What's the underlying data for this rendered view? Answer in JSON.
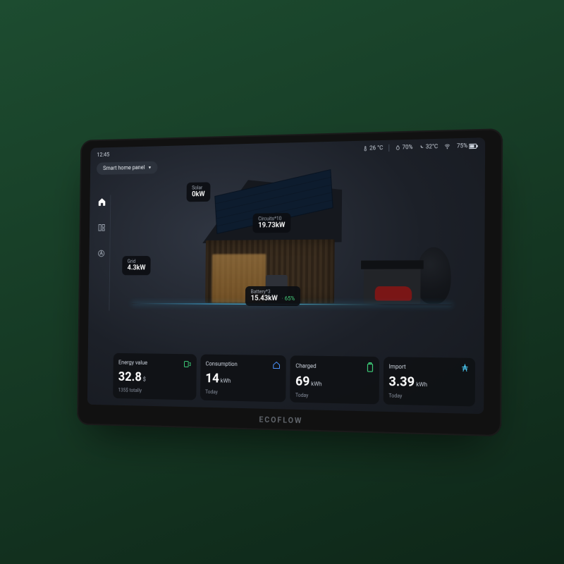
{
  "status": {
    "time": "12:45",
    "weather1_temp": "26 °C",
    "humidity": "70%",
    "weather2_temp": "32°C",
    "battery_pct": "75%"
  },
  "panel_selector": {
    "label": "Smart home panel"
  },
  "nav": {
    "home_icon": "home",
    "grid_icon": "grid",
    "auto_icon": "auto"
  },
  "bubbles": {
    "solar": {
      "label": "Solar",
      "value": "0kW"
    },
    "circuits": {
      "label": "Circuits*10",
      "value": "19.73kW"
    },
    "grid": {
      "label": "Grid",
      "value": "4.3kW"
    },
    "battery": {
      "label": "Battery*3",
      "value": "15.43kW",
      "pct": "65%"
    }
  },
  "cards": {
    "energy": {
      "title": "Energy value",
      "value": "32.8",
      "unit": "$",
      "sub": "135$ totally"
    },
    "consumption": {
      "title": "Consumption",
      "value": "14",
      "unit": "kWh",
      "sub": "Today"
    },
    "charged": {
      "title": "Charged",
      "value": "69",
      "unit": "kWh",
      "sub": "Today"
    },
    "import": {
      "title": "Import",
      "value": "3.39",
      "unit": "kWh",
      "sub": "Today"
    }
  },
  "brand": "ECOFLOW"
}
